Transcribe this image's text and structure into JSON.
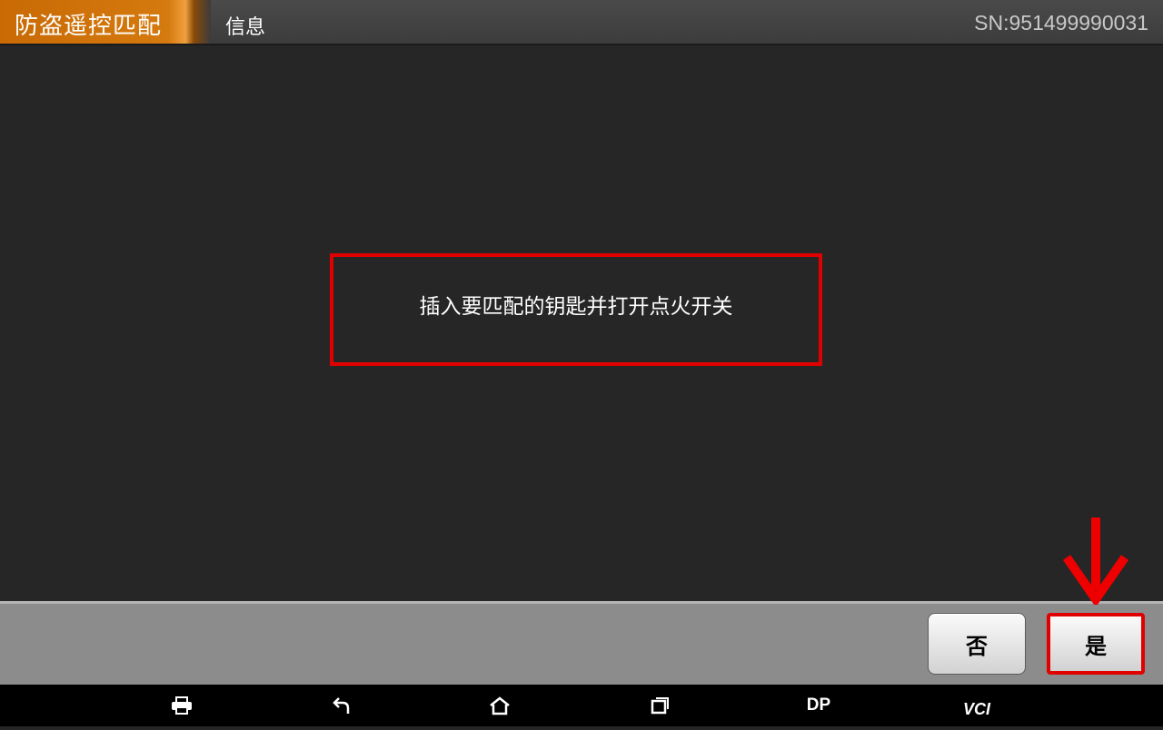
{
  "header": {
    "title": "防盗遥控匹配",
    "subtitle": "信息",
    "serial": "SN:951499990031"
  },
  "dialog": {
    "message": "插入要匹配的钥匙并打开点火开关"
  },
  "actions": {
    "no_label": "否",
    "yes_label": "是"
  },
  "navbar": {
    "dp_label": "DP",
    "vci_label": "VCI",
    "icons": [
      "printer-icon",
      "back-icon",
      "home-icon",
      "recent-apps-icon"
    ]
  },
  "colors": {
    "accent": "#d57a0e",
    "highlight": "#e00000",
    "background": "#262626"
  }
}
